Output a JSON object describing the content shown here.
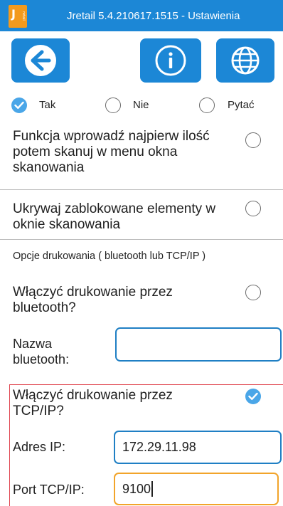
{
  "titlebar": {
    "logo_letter": "J",
    "logo_sub": "retail",
    "title": "Jretail 5.4.210617.1515 - Ustawienia"
  },
  "toolbar": {
    "back_icon": "arrow-left-icon",
    "info_icon": "info-icon",
    "language_icon": "globe-icon",
    "button_color": "#1c87d6"
  },
  "answer_mode": {
    "options": [
      {
        "label": "Tak",
        "selected": true
      },
      {
        "label": "Nie",
        "selected": false
      },
      {
        "label": "Pytać",
        "selected": false
      }
    ]
  },
  "settings": {
    "enter_qty_first": {
      "label": "Funkcja wprowadź najpierw ilość potem skanuj w menu okna skanowania",
      "checked": false
    },
    "hide_blocked": {
      "label": "Ukrywaj zablokowane elementy w oknie skanowania",
      "checked": false
    }
  },
  "print_options": {
    "section_title": "Opcje drukowania ( bluetooth lub TCP/IP )",
    "bluetooth": {
      "label": "Włączyć drukowanie przez bluetooth?",
      "checked": false,
      "name_label": "Nazwa bluetooth:",
      "name_value": ""
    },
    "tcp": {
      "label": "Włączyć drukowanie przez TCP/IP?",
      "checked": true,
      "ip_label": "Adres IP:",
      "ip_value": "172.29.11.98",
      "port_label": "Port TCP/IP:",
      "port_value": "9100"
    }
  },
  "colors": {
    "accent": "#1c87d6",
    "check": "#4aa6e8",
    "focus_border": "#f2a42a",
    "highlight_frame": "#e0454f"
  }
}
